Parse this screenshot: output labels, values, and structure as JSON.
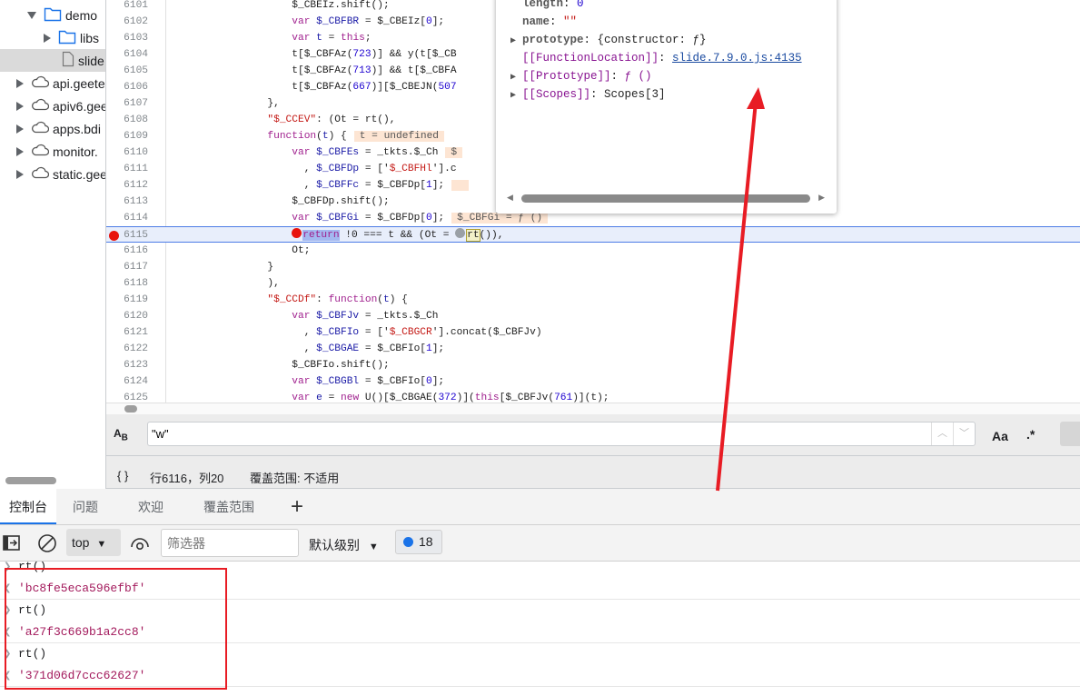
{
  "file_tree": [
    {
      "label": "demo",
      "icon": "folder-icon",
      "expanded": true,
      "level": 1
    },
    {
      "label": "libs",
      "icon": "folder-icon",
      "expanded": false,
      "level": 2
    },
    {
      "label": "slide",
      "icon": "file-icon",
      "selected": true,
      "level": 3
    },
    {
      "label": "api.geete",
      "icon": "cloud-icon",
      "expanded": false,
      "level": 0
    },
    {
      "label": "apiv6.gee",
      "icon": "cloud-icon",
      "expanded": false,
      "level": 0
    },
    {
      "label": "apps.bdi",
      "icon": "cloud-icon",
      "expanded": false,
      "level": 0
    },
    {
      "label": "monitor.",
      "icon": "cloud-icon",
      "expanded": false,
      "level": 0
    },
    {
      "label": "static.gee",
      "icon": "cloud-icon",
      "expanded": false,
      "level": 0
    }
  ],
  "editor": {
    "breakpoint_line": 6115,
    "lines": [
      {
        "n": "6101",
        "t": [
          [
            "p",
            "                    $_CBEIz.shift();"
          ]
        ]
      },
      {
        "n": "6102",
        "t": [
          [
            "k",
            "                    var "
          ],
          [
            "v",
            "$_CBFBR"
          ],
          [
            "p",
            " = $_CBEIz["
          ],
          [
            "n",
            "0"
          ],
          [
            "p",
            "];"
          ]
        ]
      },
      {
        "n": "6103",
        "t": [
          [
            "k",
            "                    var "
          ],
          [
            "v",
            "t"
          ],
          [
            "p",
            " = "
          ],
          [
            "k",
            "this"
          ],
          [
            "p",
            ";"
          ]
        ]
      },
      {
        "n": "6104",
        "t": [
          [
            "p",
            "                    t[$_CBFAz("
          ],
          [
            "n",
            "723"
          ],
          [
            "p",
            ")] && y(t[$_CB"
          ]
        ]
      },
      {
        "n": "6105",
        "t": [
          [
            "p",
            "                    t[$_CBFAz("
          ],
          [
            "n",
            "713"
          ],
          [
            "p",
            ")] && t[$_CBFA"
          ]
        ]
      },
      {
        "n": "6106",
        "t": [
          [
            "p",
            "                    t[$_CBFAz("
          ],
          [
            "n",
            "667"
          ],
          [
            "p",
            ")][$_CBEJN("
          ],
          [
            "n",
            "507"
          ]
        ]
      },
      {
        "n": "6107",
        "t": [
          [
            "p",
            "                },"
          ]
        ]
      },
      {
        "n": "6108",
        "t": [
          [
            "s",
            "                \"$_CCEV\""
          ],
          [
            "p",
            ": (Ot = rt(),"
          ]
        ]
      },
      {
        "n": "6109",
        "t": [
          [
            "k",
            "                function"
          ],
          [
            "p",
            "("
          ],
          [
            "v",
            "t"
          ],
          [
            "p",
            ") {"
          ]
        ],
        "ann": "t = undefined"
      },
      {
        "n": "6110",
        "t": [
          [
            "k",
            "                    var "
          ],
          [
            "v",
            "$_CBFEs"
          ],
          [
            "p",
            " = _tkts.$_Ch"
          ]
        ],
        "ann": "$"
      },
      {
        "n": "6111",
        "t": [
          [
            "p",
            "                      , "
          ],
          [
            "v",
            "$_CBFDp"
          ],
          [
            "p",
            " = ['"
          ],
          [
            "s",
            "$_CBFHl"
          ],
          [
            "p",
            "'].c"
          ]
        ]
      },
      {
        "n": "6112",
        "t": [
          [
            "p",
            "                      , "
          ],
          [
            "v",
            "$_CBFFc"
          ],
          [
            "p",
            " = $_CBFDp["
          ],
          [
            "n",
            "1"
          ],
          [
            "p",
            "];"
          ]
        ],
        "ann": " "
      },
      {
        "n": "6113",
        "t": [
          [
            "p",
            "                    $_CBFDp.shift();"
          ]
        ]
      },
      {
        "n": "6114",
        "t": [
          [
            "k",
            "                    var "
          ],
          [
            "v",
            "$_CBFGi"
          ],
          [
            "p",
            " = $_CBFDp["
          ],
          [
            "n",
            "0"
          ],
          [
            "p",
            "];"
          ]
        ],
        "ann": "$_CBFGi = ƒ ()"
      },
      {
        "n": "6115",
        "t": [
          [
            "bp",
            ""
          ],
          [
            "ret",
            "return"
          ],
          [
            "p",
            " !0 === t && (Ot = "
          ],
          [
            "bpg",
            ""
          ],
          [
            "rt",
            "rt"
          ],
          [
            "p",
            "()),"
          ]
        ],
        "current": true
      },
      {
        "n": "6116",
        "t": [
          [
            "p",
            "                    Ot;"
          ]
        ]
      },
      {
        "n": "6117",
        "t": [
          [
            "p",
            "                }"
          ]
        ]
      },
      {
        "n": "6118",
        "t": [
          [
            "p",
            "                ),"
          ]
        ]
      },
      {
        "n": "6119",
        "t": [
          [
            "s",
            "                \"$_CCDf\""
          ],
          [
            "p",
            ": "
          ],
          [
            "k",
            "function"
          ],
          [
            "p",
            "("
          ],
          [
            "v",
            "t"
          ],
          [
            "p",
            ") {"
          ]
        ]
      },
      {
        "n": "6120",
        "t": [
          [
            "k",
            "                    var "
          ],
          [
            "v",
            "$_CBFJv"
          ],
          [
            "p",
            " = _tkts.$_Ch"
          ]
        ]
      },
      {
        "n": "6121",
        "t": [
          [
            "p",
            "                      , "
          ],
          [
            "v",
            "$_CBFIo"
          ],
          [
            "p",
            " = ['"
          ],
          [
            "s",
            "$_CBGCR"
          ],
          [
            "p",
            "'].concat($_CBFJv)"
          ]
        ]
      },
      {
        "n": "6122",
        "t": [
          [
            "p",
            "                      , "
          ],
          [
            "v",
            "$_CBGAE"
          ],
          [
            "p",
            " = $_CBFIo["
          ],
          [
            "n",
            "1"
          ],
          [
            "p",
            "];"
          ]
        ]
      },
      {
        "n": "6123",
        "t": [
          [
            "p",
            "                    $_CBFIo.shift();"
          ]
        ]
      },
      {
        "n": "6124",
        "t": [
          [
            "k",
            "                    var "
          ],
          [
            "v",
            "$_CBGBl"
          ],
          [
            "p",
            " = $_CBFIo["
          ],
          [
            "n",
            "0"
          ],
          [
            "p",
            "];"
          ]
        ]
      },
      {
        "n": "6125",
        "t": [
          [
            "k",
            "                    var "
          ],
          [
            "v",
            "e"
          ],
          [
            "p",
            " = "
          ],
          [
            "k",
            "new"
          ],
          [
            "p",
            " U()[$_CBGAE("
          ],
          [
            "n",
            "372"
          ],
          [
            "p",
            ")]("
          ],
          [
            "k",
            "this"
          ],
          [
            "p",
            "[$_CBFJv("
          ],
          [
            "n",
            "761"
          ],
          [
            "p",
            ")](t);"
          ]
        ]
      }
    ]
  },
  "popover": {
    "rows": [
      {
        "key": "length",
        "sep": ": ",
        "val": "0",
        "vclass": "n"
      },
      {
        "key": "name",
        "sep": ": ",
        "val": "\"\"",
        "vclass": "s"
      },
      {
        "key": "prototype",
        "sep": ": ",
        "val": "{constructor: ƒ}",
        "vclass": "p",
        "expandable": true
      },
      {
        "key": "[[FunctionLocation]]",
        "sep": ": ",
        "val": "slide.7.9.0.js:4135",
        "vclass": "link",
        "internal": true
      },
      {
        "key": "[[Prototype]]",
        "sep": ": ",
        "val": "ƒ ()",
        "vclass": "pk",
        "expandable": true,
        "internal": true
      },
      {
        "key": "[[Scopes]]",
        "sep": ": ",
        "val": "Scopes[3]",
        "vclass": "p",
        "expandable": true,
        "internal": true
      }
    ]
  },
  "search": {
    "value": "\"w\"",
    "case_label": "Aa",
    "regex_label": ".*",
    "replace_icon": "replace-ab-icon"
  },
  "status": {
    "braces": "{ }",
    "position": "行6116，列20",
    "coverage": "覆盖范围: 不适用"
  },
  "drawer_tabs": [
    {
      "label": "控制台",
      "active": true
    },
    {
      "label": "问题"
    },
    {
      "label": "欢迎"
    },
    {
      "label": "覆盖范围"
    }
  ],
  "add_tab": "+",
  "console_toolbar": {
    "context": "top",
    "filter_placeholder": "筛选器",
    "level": "默认级别",
    "message_count": "18"
  },
  "console": [
    {
      "type": "input",
      "text": "rt()"
    },
    {
      "type": "output",
      "text": "'bc8fe5eca596efbf'"
    },
    {
      "type": "input",
      "text": "rt()"
    },
    {
      "type": "output",
      "text": "'a27f3c669b1a2cc8'"
    },
    {
      "type": "input",
      "text": "rt()"
    },
    {
      "type": "output",
      "text": "'371d06d7ccc62627'"
    }
  ],
  "colors": {
    "annotation_red": "#e81c24",
    "breakpoint": "#e8130d",
    "accent": "#1a73e8"
  }
}
